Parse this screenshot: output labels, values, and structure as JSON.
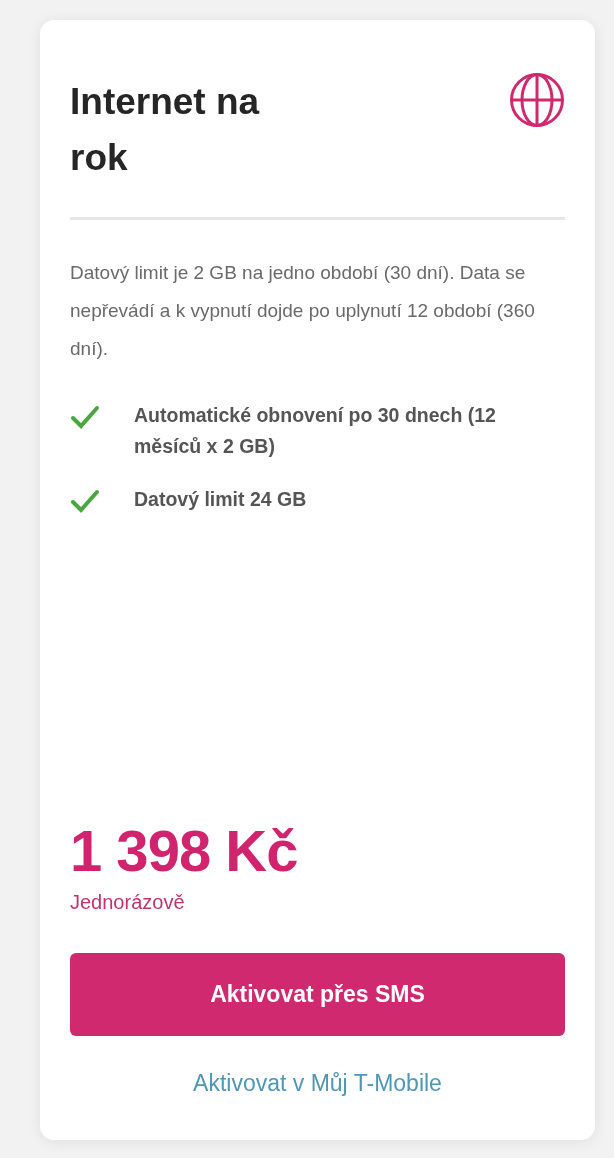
{
  "card": {
    "title": "Internet na rok",
    "description": "Datový limit je 2 GB na jedno období (30 dní). Data se nepřevádí a k vypnutí dojde po uplynutí 12 období (360 dní).",
    "features": [
      {
        "text": "Automatické obnovení po 30 dnech (12 měsíců x 2 GB)",
        "included": true
      },
      {
        "text": "Datový limit 24 GB",
        "included": true
      }
    ],
    "price": "1 398 Kč",
    "price_note": "Jednorázově",
    "primary_button": "Aktivovat přes SMS",
    "secondary_link": "Aktivovat v Můj T-Mobile"
  }
}
